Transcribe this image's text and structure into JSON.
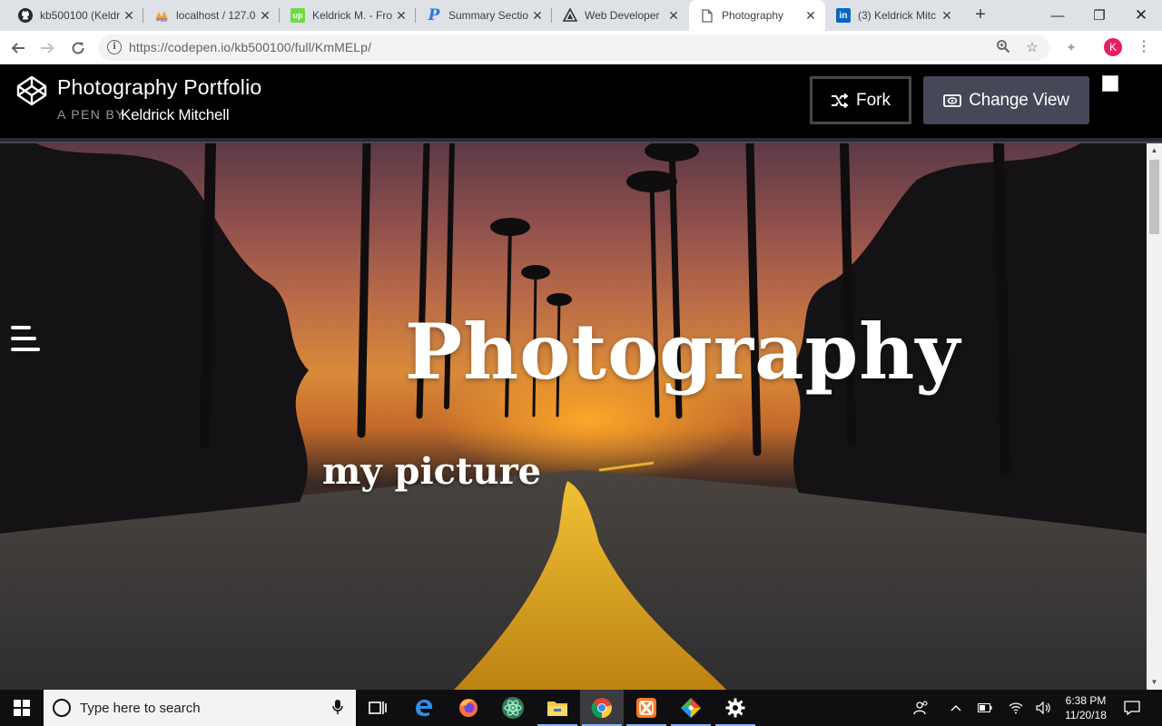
{
  "browser": {
    "tabs": [
      {
        "title": "kb500100 (Keldr",
        "favicon": "github-icon",
        "active": false
      },
      {
        "title": "localhost / 127.0",
        "favicon": "phpmyadmin-icon",
        "active": false
      },
      {
        "title": "Keldrick M. - Fro",
        "favicon": "upwork-icon",
        "active": false
      },
      {
        "title": "Summary Sectio",
        "favicon": "p-icon",
        "active": false
      },
      {
        "title": "Web Developer",
        "favicon": "triangle-icon",
        "active": false
      },
      {
        "title": "Photography",
        "favicon": "document-icon",
        "active": true
      },
      {
        "title": "(3) Keldrick Mitc",
        "favicon": "linkedin-icon",
        "active": false
      }
    ],
    "url": "https://codepen.io/kb500100/full/KmMELp/",
    "profile_initial": "K"
  },
  "codepen": {
    "title": "Photography Portfolio",
    "byline": "A PEN BY",
    "author": "Keldrick Mitchell",
    "fork_label": "Fork",
    "change_view_label": "Change View"
  },
  "hero": {
    "title": "Photography",
    "subtitle": "my picture"
  },
  "taskbar": {
    "search_placeholder": "Type here to search",
    "time": "6:38 PM",
    "date": "11/20/18",
    "apps": [
      "task-view-icon",
      "edge-icon",
      "firefox-icon",
      "atom-icon",
      "file-explorer-icon",
      "chrome-icon",
      "xampp-icon",
      "git-icon",
      "settings-icon"
    ]
  },
  "colors": {
    "codepen_header": "#000000",
    "change_view_button": "#444857",
    "avatar": "#e91e63",
    "taskbar": "#0f0f12"
  }
}
